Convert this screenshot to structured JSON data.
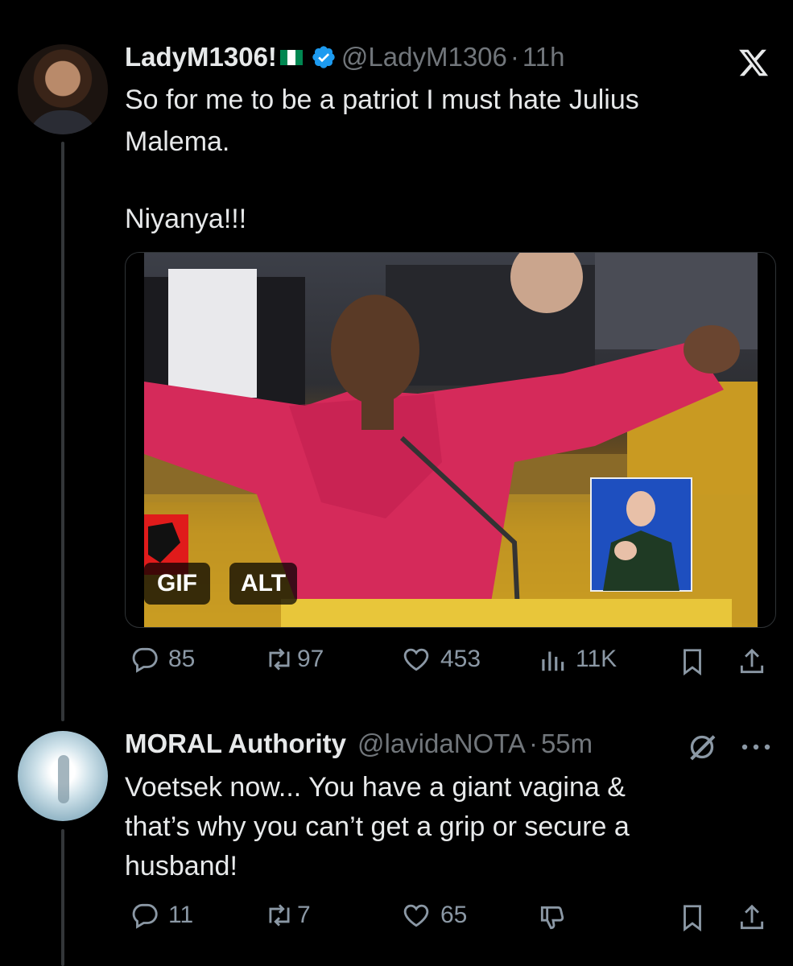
{
  "tweets": [
    {
      "name": "LadyM1306!",
      "handle": "@LadyM1306",
      "time_sep": "·",
      "time": "11h",
      "lines": [
        "So for me to be a patriot I must hate Julius",
        "Malema.",
        "",
        "Niyanya!!!"
      ],
      "media": {
        "badges": [
          "GIF",
          "ALT"
        ]
      },
      "stats": {
        "replies": "85",
        "reposts": "97",
        "likes": "453",
        "views": "11K"
      }
    },
    {
      "name": "MORAL Authority",
      "handle": "@lavidaNOTA",
      "time_sep": "·",
      "time": "55m",
      "lines": [
        "Voetsek now... You have a giant vagina &",
        "that’s why you can’t get a grip or secure a",
        "husband!"
      ],
      "stats": {
        "replies": "11",
        "reposts": "7",
        "likes": "65"
      }
    }
  ],
  "icons": {
    "close": "x-logo-icon",
    "verified": "verified-badge-icon",
    "grok": "grok-icon",
    "more": "more-icon"
  },
  "colors": {
    "background": "#000000",
    "text": "#e7e9ea",
    "muted": "#71767b",
    "verified": "#1d9bf0"
  }
}
